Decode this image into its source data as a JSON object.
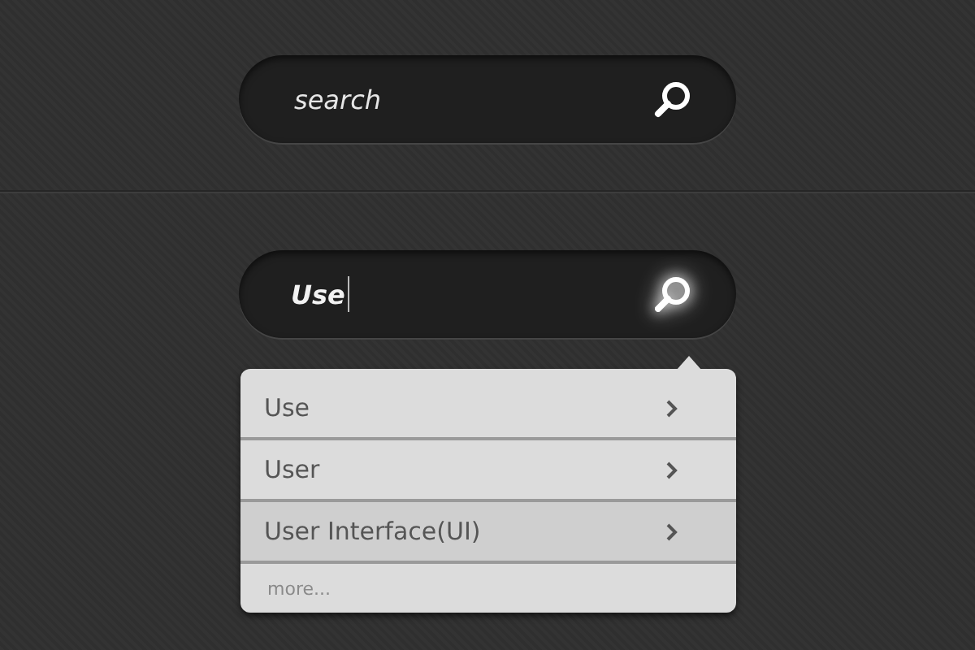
{
  "search_fields": [
    {
      "placeholder": "search",
      "focused": false
    },
    {
      "value": "Use",
      "focused": true
    }
  ],
  "suggestions": {
    "items": [
      {
        "label": "Use",
        "selected": false
      },
      {
        "label": "User",
        "selected": false
      },
      {
        "label": "User Interface(UI)",
        "selected": true
      }
    ],
    "more": "more..."
  }
}
